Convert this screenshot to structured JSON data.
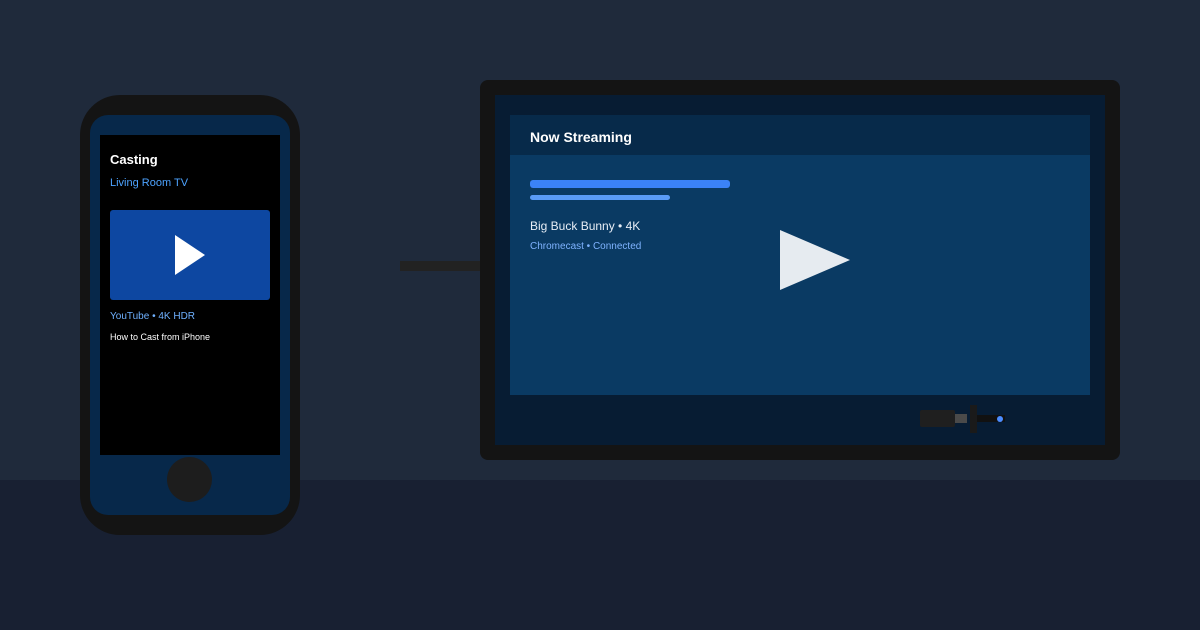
{
  "phone": {
    "title": "Casting",
    "device": "Living Room TV",
    "source": "YouTube • 4K HDR",
    "video_title": "How to Cast from iPhone",
    "thumbnail_icon": "play-icon"
  },
  "tv": {
    "header": "Now Streaming",
    "video_title": "Big Buck Bunny • 4K",
    "status": "Chromecast • Connected",
    "play_icon": "play-icon"
  },
  "dongle": {
    "icon": "chromecast-dongle-icon",
    "led_color": "#4c8dff"
  },
  "colors": {
    "background": "#1f2a3b",
    "floor": "#182032",
    "accent": "#3b82f6",
    "phone_thumbnail": "#0d47a1",
    "tv_content": "#0a3a63",
    "device_text": "#4da3ff"
  }
}
